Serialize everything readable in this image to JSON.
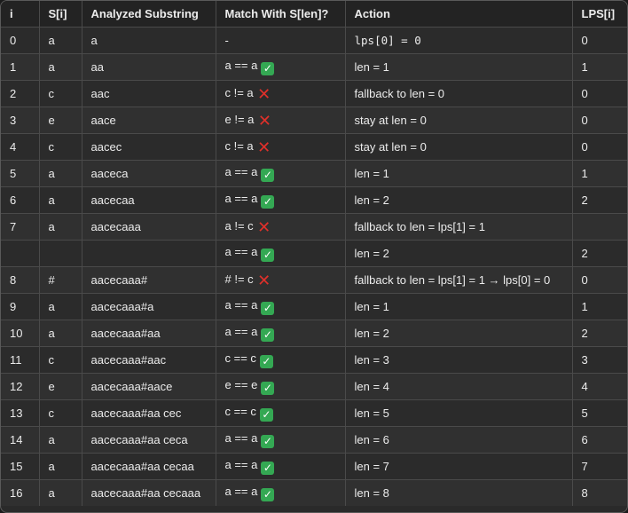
{
  "headers": [
    "i",
    "S[i]",
    "Analyzed Substring",
    "Match With S[len]?",
    "Action",
    "LPS[i]"
  ],
  "rows": [
    {
      "i": "0",
      "s": "a",
      "sub": "a",
      "match": "-",
      "mark": "",
      "action": "lps[0] = 0",
      "action_mono": true,
      "lps": "0"
    },
    {
      "i": "1",
      "s": "a",
      "sub": "aa",
      "match": "a == a",
      "mark": "ok",
      "action": "len = 1",
      "lps": "1"
    },
    {
      "i": "2",
      "s": "c",
      "sub": "aac",
      "match": "c != a",
      "mark": "bad",
      "action": "fallback to len = 0",
      "lps": "0"
    },
    {
      "i": "3",
      "s": "e",
      "sub": "aace",
      "match": "e != a",
      "mark": "bad",
      "action": "stay at len = 0",
      "lps": "0"
    },
    {
      "i": "4",
      "s": "c",
      "sub": "aacec",
      "match": "c != a",
      "mark": "bad",
      "action": "stay at len = 0",
      "lps": "0"
    },
    {
      "i": "5",
      "s": "a",
      "sub": "aaceca",
      "match": "a == a",
      "mark": "ok",
      "action": "len = 1",
      "lps": "1"
    },
    {
      "i": "6",
      "s": "a",
      "sub": "aacecaa",
      "match": "a == a",
      "mark": "ok",
      "action": "len = 2",
      "lps": "2"
    },
    {
      "i": "7",
      "s": "a",
      "sub": "aacecaaa",
      "match": "a != c",
      "mark": "bad",
      "action": "fallback to len = lps[1] = 1",
      "lps": ""
    },
    {
      "i": "",
      "s": "",
      "sub": "",
      "match": "a == a",
      "mark": "ok",
      "action": "len = 2",
      "lps": "2"
    },
    {
      "i": "8",
      "s": "#",
      "sub": "aacecaaa#",
      "match": "# != c",
      "mark": "bad",
      "action": "fallback to len = lps[1] = 1 → lps[0] = 0",
      "lps": "0"
    },
    {
      "i": "9",
      "s": "a",
      "sub": "aacecaaa#a",
      "match": "a == a",
      "mark": "ok",
      "action": "len = 1",
      "lps": "1"
    },
    {
      "i": "10",
      "s": "a",
      "sub": "aacecaaa#aa",
      "match": "a == a",
      "mark": "ok",
      "action": "len = 2",
      "lps": "2"
    },
    {
      "i": "11",
      "s": "c",
      "sub": "aacecaaa#aac",
      "match": "c == c",
      "mark": "ok",
      "action": "len = 3",
      "lps": "3"
    },
    {
      "i": "12",
      "s": "e",
      "sub": "aacecaaa#aace",
      "match": "e == e",
      "mark": "ok",
      "action": "len = 4",
      "lps": "4"
    },
    {
      "i": "13",
      "s": "c",
      "sub": "aacecaaa#aa cec",
      "match": "c == c",
      "mark": "ok",
      "action": "len = 5",
      "lps": "5"
    },
    {
      "i": "14",
      "s": "a",
      "sub": "aacecaaa#aa ceca",
      "match": "a == a",
      "mark": "ok",
      "action": "len = 6",
      "lps": "6"
    },
    {
      "i": "15",
      "s": "a",
      "sub": "aacecaaa#aa cecaa",
      "match": "a == a",
      "mark": "ok",
      "action": "len = 7",
      "lps": "7"
    },
    {
      "i": "16",
      "s": "a",
      "sub": "aacecaaa#aa cecaaa",
      "match": "a == a",
      "mark": "ok",
      "action": "len = 8",
      "lps": "8"
    }
  ],
  "icons": {
    "ok": {
      "name": "check-mark-icon",
      "glyph": "✓",
      "color": "#34a853"
    },
    "bad": {
      "name": "cross-mark-icon",
      "glyph": "✕",
      "color": "#e0302a"
    }
  }
}
